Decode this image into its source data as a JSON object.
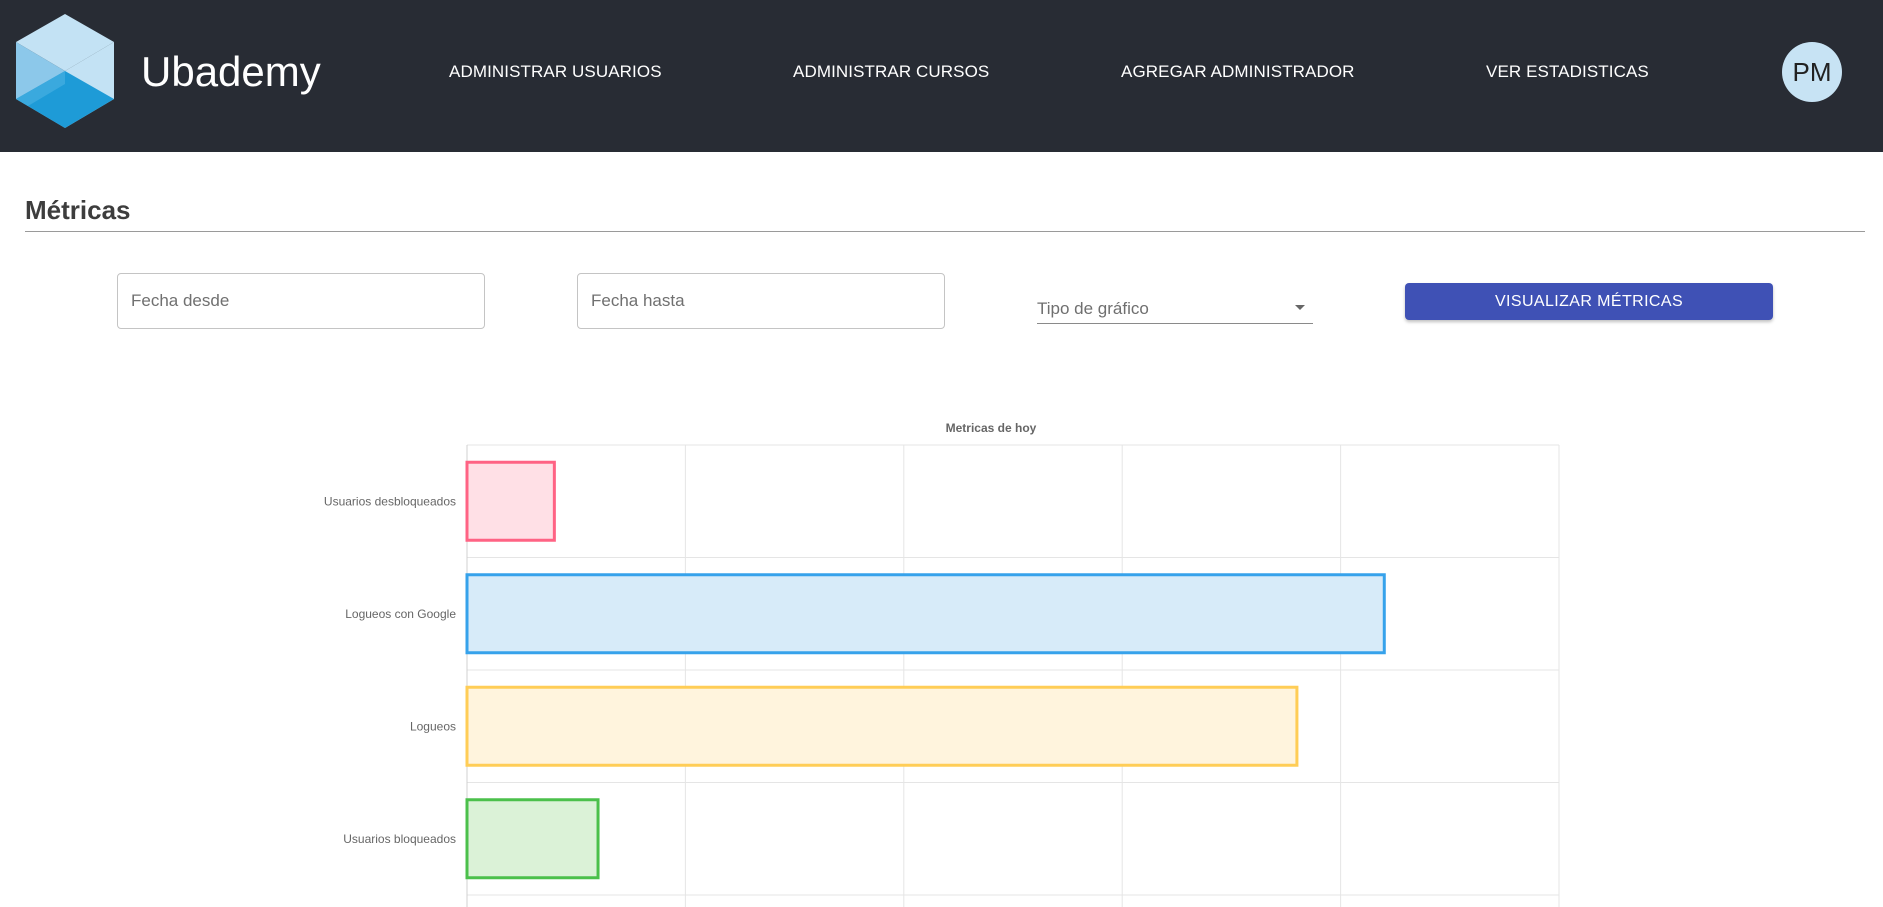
{
  "header": {
    "brand": "Ubademy",
    "nav": [
      {
        "label": "ADMINISTRAR USUARIOS"
      },
      {
        "label": "ADMINISTRAR CURSOS"
      },
      {
        "label": "AGREGAR ADMINISTRADOR"
      },
      {
        "label": "VER ESTADISTICAS"
      }
    ],
    "avatar_initials": "PM",
    "logo_icon": "hexagon-logo-icon"
  },
  "metrics": {
    "title": "Métricas",
    "date_from": {
      "placeholder": "Fecha desde",
      "value": ""
    },
    "date_to": {
      "placeholder": "Fecha hasta",
      "value": ""
    },
    "chart_type_select": {
      "label": "Tipo de gráfico"
    },
    "submit_label": "VISUALIZAR MÉTRICAS"
  },
  "colors": {
    "header_bg": "#282c34",
    "primary": "#3f51b5",
    "avatar_bg": "#c7e3f4"
  },
  "chart_data": {
    "type": "bar",
    "orientation": "horizontal",
    "title": "Metricas de hoy",
    "categories": [
      "Usuarios desbloqueados",
      "Logueos con Google",
      "Logueos",
      "Usuarios bloqueados"
    ],
    "values": [
      2,
      21,
      19,
      3
    ],
    "xlim": [
      0,
      25
    ],
    "grid": true,
    "styles": [
      {
        "fill": "#ffe0e6",
        "stroke": "#ff6384"
      },
      {
        "fill": "#d7ebf9",
        "stroke": "#36a2eb"
      },
      {
        "fill": "#fff4dd",
        "stroke": "#ffcd56"
      },
      {
        "fill": "#dbf2d7",
        "stroke": "#4bc04b"
      }
    ]
  }
}
